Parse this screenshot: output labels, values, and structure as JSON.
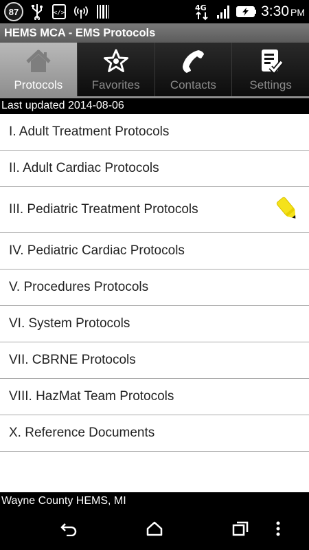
{
  "status_bar": {
    "notification_count": "87",
    "network": "4G",
    "time": "3:30",
    "ampm": "PM"
  },
  "app": {
    "title": "HEMS MCA - EMS Protocols"
  },
  "tabs": [
    {
      "label": "Protocols",
      "icon": "home-icon",
      "active": true
    },
    {
      "label": "Favorites",
      "icon": "star-icon",
      "active": false
    },
    {
      "label": "Contacts",
      "icon": "phone-icon",
      "active": false
    },
    {
      "label": "Settings",
      "icon": "checklist-icon",
      "active": false
    }
  ],
  "last_updated": "Last updated 2014-08-06",
  "protocols": [
    {
      "label": "I. Adult Treatment Protocols"
    },
    {
      "label": "II. Adult Cardiac Protocols"
    },
    {
      "label": "III. Pediatric Treatment Protocols",
      "badge_icon": "pencil-icon"
    },
    {
      "label": "IV. Pediatric Cardiac Protocols"
    },
    {
      "label": "V. Procedures Protocols"
    },
    {
      "label": "VI. System Protocols"
    },
    {
      "label": "VII. CBRNE Protocols"
    },
    {
      "label": "VIII. HazMat Team Protocols"
    },
    {
      "label": "X. Reference Documents"
    }
  ],
  "footer": "Wayne County HEMS, MI",
  "colors": {
    "accent_pencil": "#f5e21b",
    "active_tab": "#a4a4a4"
  }
}
